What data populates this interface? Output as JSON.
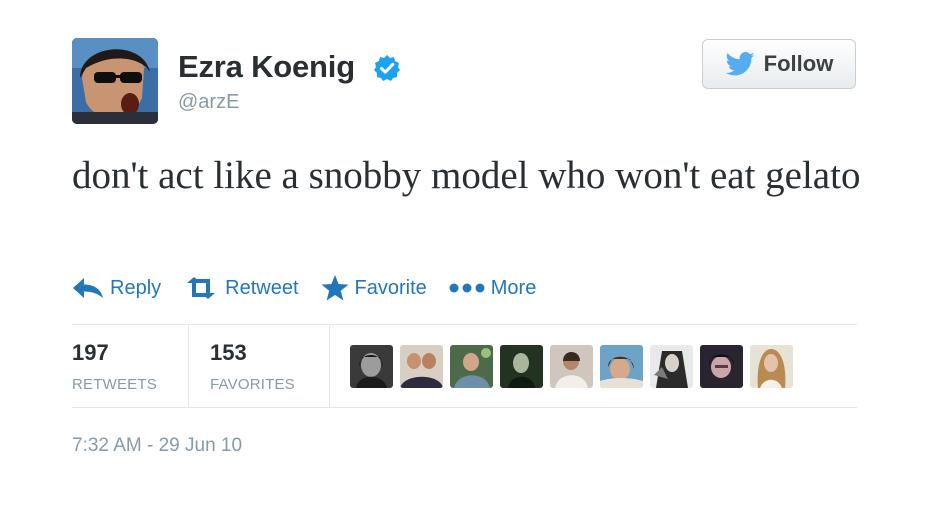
{
  "user": {
    "display_name": "Ezra Koenig",
    "handle": "@arzE",
    "verified": true,
    "avatar_icon": "profile-photo"
  },
  "follow_button": {
    "label": "Follow",
    "icon": "twitter-bird-icon"
  },
  "tweet": {
    "text": "don't act like a snobby model who won't eat gelato"
  },
  "actions": [
    {
      "label": "Reply",
      "icon": "reply-arrow-icon"
    },
    {
      "label": "Retweet",
      "icon": "retweet-icon"
    },
    {
      "label": "Favorite",
      "icon": "star-icon"
    },
    {
      "label": "More",
      "icon": "more-dots-icon"
    }
  ],
  "stats": {
    "retweets": {
      "count": "197",
      "label": "RETWEETS"
    },
    "favorites": {
      "count": "153",
      "label": "FAVORITES"
    }
  },
  "timestamp": "7:32 AM - 29 Jun 10",
  "colors": {
    "link_blue": "#2277bb",
    "twitter_blue": "#55acee",
    "verified_blue": "#1da1f2",
    "muted_gray": "#8899a6",
    "text_dark": "#292f33",
    "divider": "#e1e8ed"
  }
}
